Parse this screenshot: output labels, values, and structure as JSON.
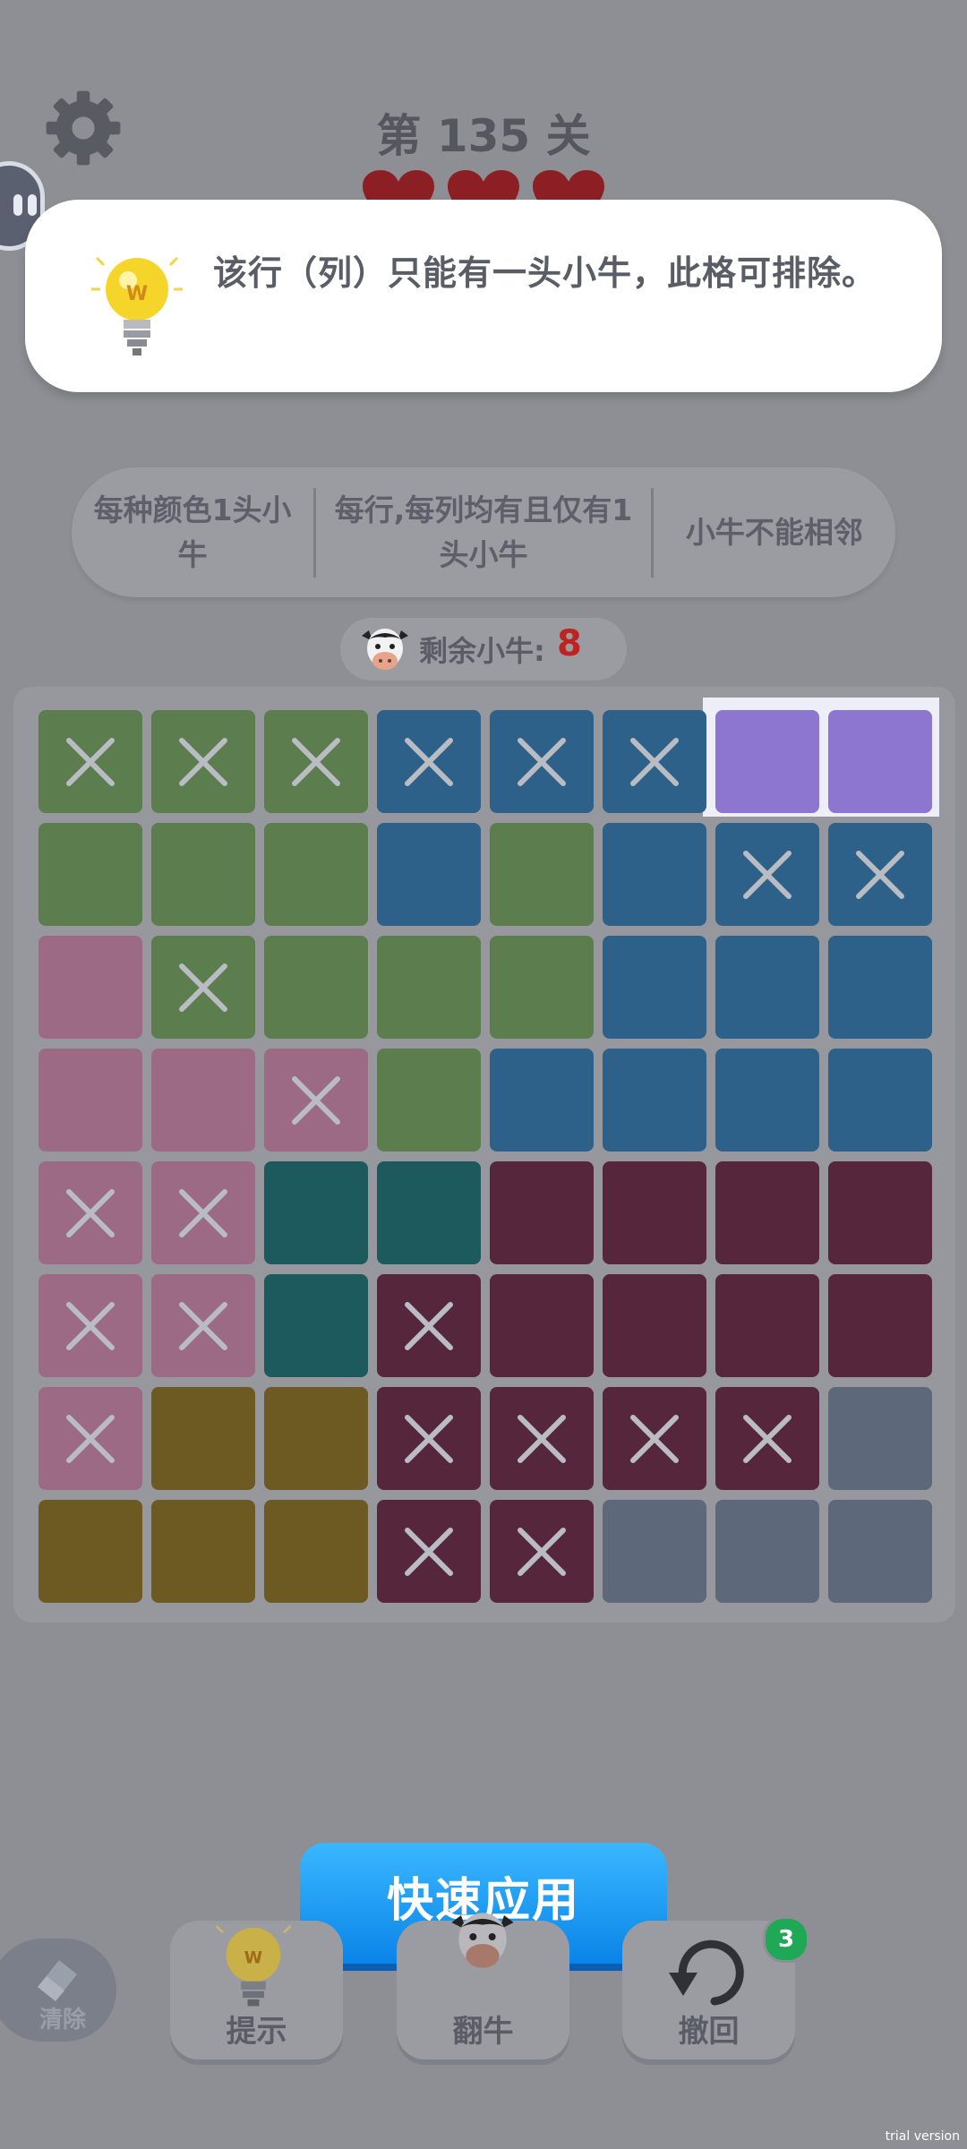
{
  "header": {
    "level_title": "第 135 关",
    "hearts": 3
  },
  "tooltip": {
    "text": "该行（列）只能有一头小牛，此格可排除。",
    "icon": "lightbulb-icon"
  },
  "rules": [
    "每种颜色1头小牛",
    "每行,每列均有且仅有1头小牛",
    "小牛不能相邻"
  ],
  "remaining": {
    "label": "剩余小牛:",
    "count": "8"
  },
  "colors": {
    "G": "#5c7d4e",
    "B": "#2e6189",
    "P": "#8c76d0",
    "K": "#9c6a84",
    "T": "#1c5a5d",
    "M": "#56263d",
    "Y": "#6d5a23",
    "S": "#5d697b"
  },
  "board": {
    "rows": [
      [
        "G",
        "G",
        "G",
        "B",
        "B",
        "B",
        "P",
        "P"
      ],
      [
        "G",
        "G",
        "G",
        "B",
        "G",
        "B",
        "B",
        "B"
      ],
      [
        "K",
        "G",
        "G",
        "G",
        "G",
        "B",
        "B",
        "B"
      ],
      [
        "K",
        "K",
        "K",
        "G",
        "B",
        "B",
        "B",
        "B"
      ],
      [
        "K",
        "K",
        "T",
        "T",
        "M",
        "M",
        "M",
        "M"
      ],
      [
        "K",
        "K",
        "T",
        "M",
        "M",
        "M",
        "M",
        "M"
      ],
      [
        "K",
        "Y",
        "Y",
        "M",
        "M",
        "M",
        "M",
        "S"
      ],
      [
        "Y",
        "Y",
        "Y",
        "M",
        "M",
        "S",
        "S",
        "S"
      ]
    ],
    "marks": [
      [
        1,
        1,
        1,
        1,
        1,
        1,
        0,
        0
      ],
      [
        0,
        0,
        0,
        0,
        0,
        0,
        1,
        1
      ],
      [
        0,
        1,
        0,
        0,
        0,
        0,
        0,
        0
      ],
      [
        0,
        0,
        1,
        0,
        0,
        0,
        0,
        0
      ],
      [
        1,
        1,
        0,
        0,
        0,
        0,
        0,
        0
      ],
      [
        1,
        1,
        0,
        1,
        0,
        0,
        0,
        0
      ],
      [
        1,
        0,
        0,
        1,
        1,
        1,
        1,
        0
      ],
      [
        0,
        0,
        0,
        1,
        1,
        0,
        0,
        0
      ]
    ],
    "highlight": {
      "row": 0,
      "cols": [
        6,
        7
      ]
    }
  },
  "actions": {
    "apply": "快速应用",
    "clear": "清除",
    "hint": "提示",
    "flip": "翻牛",
    "undo": "撤回",
    "undo_count": "3"
  },
  "watermark": "trial version"
}
